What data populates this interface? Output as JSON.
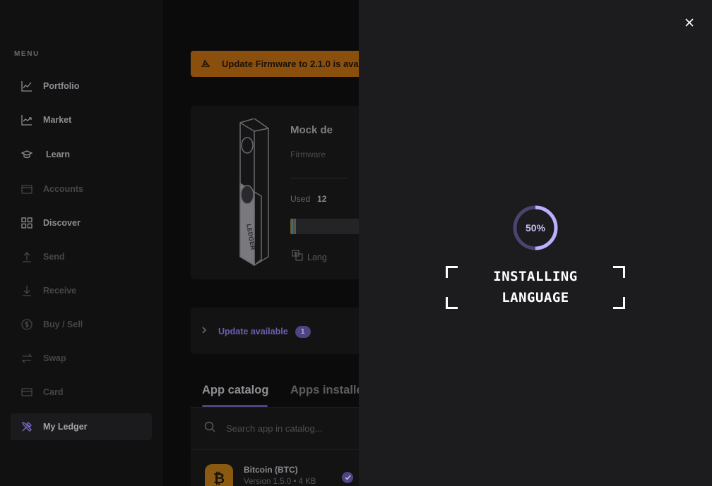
{
  "sidebar": {
    "menu_label": "MENU",
    "items": [
      {
        "label": "Portfolio",
        "icon": "chart-line-icon"
      },
      {
        "label": "Market",
        "icon": "market-trend-icon"
      },
      {
        "label": "Learn",
        "icon": "graduation-cap-icon"
      },
      {
        "label": "Accounts",
        "icon": "wallet-icon"
      },
      {
        "label": "Discover",
        "icon": "grid-icon"
      },
      {
        "label": "Send",
        "icon": "arrow-up-icon"
      },
      {
        "label": "Receive",
        "icon": "arrow-down-icon"
      },
      {
        "label": "Buy / Sell",
        "icon": "dollar-circle-icon"
      },
      {
        "label": "Swap",
        "icon": "swap-arrows-icon"
      },
      {
        "label": "Card",
        "icon": "credit-card-icon"
      },
      {
        "label": "My Ledger",
        "icon": "tools-icon"
      }
    ],
    "active_item": "My Ledger"
  },
  "main": {
    "banner": {
      "text": "Update Firmware to 2.1.0 is ava",
      "color": "#8a4f0d"
    },
    "device": {
      "name": "Mock de",
      "firmware_label": "Firmware",
      "used_label": "Used",
      "used_value": "12",
      "language_label": "Lang"
    },
    "update": {
      "label": "Update available",
      "count": "1"
    },
    "tabs": [
      {
        "label": "App catalog",
        "active": true
      },
      {
        "label": "Apps installe",
        "active": false
      }
    ],
    "search": {
      "placeholder": "Search app in catalog..."
    },
    "apps": [
      {
        "name": "Bitcoin (BTC)",
        "version": "Version 1.5.0 • 4 KB",
        "icon_letter": "₿",
        "color": "#8a5a11"
      }
    ]
  },
  "drawer": {
    "progress": {
      "percent": 50,
      "label": "50%"
    },
    "title": "INSTALLING\nLANGUAGE",
    "accent_color": "#bbb0ff"
  }
}
